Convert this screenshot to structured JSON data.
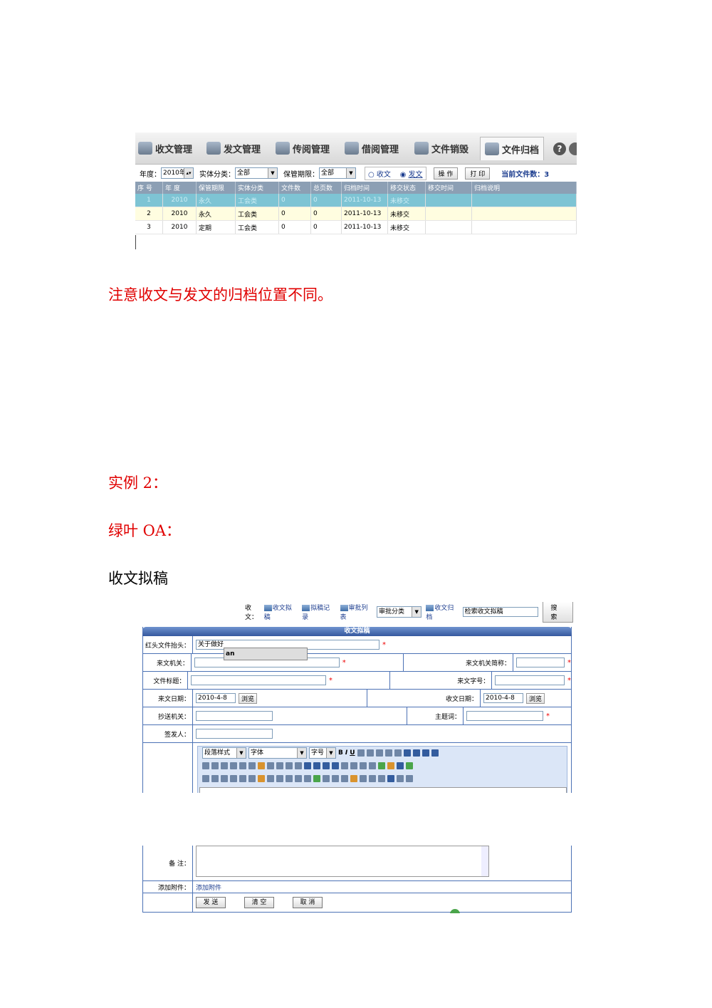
{
  "screenshot1": {
    "tabs": [
      {
        "label": "收文管理"
      },
      {
        "label": "发文管理"
      },
      {
        "label": "传阅管理"
      },
      {
        "label": "借阅管理"
      },
      {
        "label": "文件销毁"
      },
      {
        "label": "文件归档",
        "active": true
      }
    ],
    "help_icon": "?",
    "filter": {
      "year_label": "年度：",
      "year_value": "2010年",
      "entity_label": "实体分类：",
      "entity_value": "全部",
      "period_label": "保管期限：",
      "period_value": "全部",
      "radio_receive": "收文",
      "radio_send": "发文",
      "selected_radio": "发文",
      "operate_button": "操 作",
      "print_button": "打 印",
      "count_text": "当前文件数：3"
    },
    "table": {
      "headers": [
        "序 号",
        "年 度",
        "保管期限",
        "实体分类",
        "文件数",
        "总页数",
        "归档时间",
        "移交状态",
        "移交时间",
        "归档说明"
      ],
      "rows": [
        [
          "1",
          "2010",
          "永久",
          "工会类",
          "0",
          "0",
          "2011-10-13",
          "未移交",
          "",
          ""
        ],
        [
          "2",
          "2010",
          "永久",
          "工会类",
          "0",
          "0",
          "2011-10-13",
          "未移交",
          "",
          ""
        ],
        [
          "3",
          "2010",
          "定期",
          "工会类",
          "0",
          "0",
          "2011-10-13",
          "未移交",
          "",
          ""
        ]
      ]
    }
  },
  "doc": {
    "note": "注意收文与发文的归档位置不同。",
    "example_heading": "实例 2：",
    "product_heading": "绿叶 OA：",
    "section_heading": "收文拟稿"
  },
  "screenshot2": {
    "toolbar": {
      "prefix": "收文：",
      "link_draft": "收文拟稿",
      "link_records": "拟稿记录",
      "link_approval": "审批列表",
      "category_value": "审批分类",
      "link_archive": "收文归档",
      "search_value": "检索收文拟稿",
      "search_button": "搜 索"
    },
    "panel_title": "收文拟稿",
    "form": {
      "header_label": "红头文件抬头：",
      "header_value": "关于做好",
      "autocomplete": "an",
      "org_label": "来文机关：",
      "org_short_label": "来文机关简称：",
      "title_label": "文件标题：",
      "doc_no_label": "来文字号：",
      "date_label": "来文日期：",
      "date_value": "2010-4-8",
      "browse": "浏览",
      "recv_date_label": "收文日期：",
      "recv_date_value": "2010-4-8",
      "cc_label": "抄送机关：",
      "keyword_label": "主题词：",
      "signer_label": "签发人：",
      "editor_paragraph": "段落样式",
      "editor_font": "字体",
      "editor_size": "字号",
      "remark_label": "备 注：",
      "attach_label": "添加附件：",
      "attach_link": "添加附件",
      "btn_send": "发 送",
      "btn_clear": "清 空",
      "btn_cancel": "取 消"
    }
  }
}
